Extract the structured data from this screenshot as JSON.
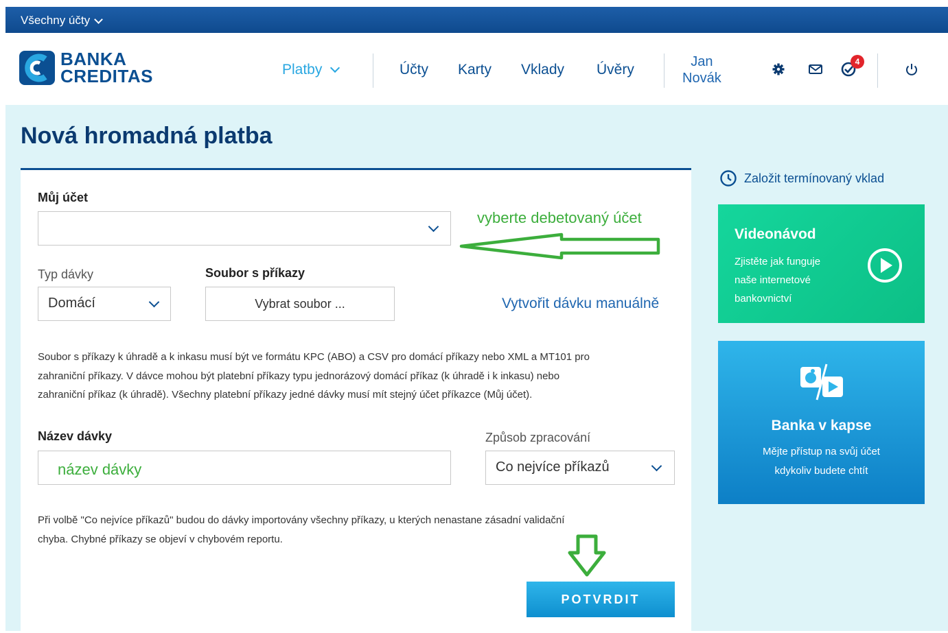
{
  "topbar": {
    "accounts_label": "Všechny účty"
  },
  "brand": {
    "line1": "BANKA",
    "line2": "CREDITAS"
  },
  "nav": {
    "payments": "Platby",
    "accounts": "Účty",
    "cards": "Karty",
    "deposits": "Vklady",
    "loans": "Úvěry"
  },
  "user": {
    "first_name": "Jan",
    "last_name": "Novák"
  },
  "notifications": {
    "count": "4"
  },
  "icons": {
    "settings": "gear-icon",
    "messages": "envelope-icon",
    "tasks": "check-badge-icon",
    "logout": "power-icon"
  },
  "page": {
    "title": "Nová hromadná platba"
  },
  "form": {
    "my_account_label": "Můj účet",
    "my_account_value": "",
    "batch_type_label": "Typ dávky",
    "batch_type_value": "Domácí",
    "file_label": "Soubor s příkazy",
    "file_button": "Vybrat soubor ...",
    "manual_link": "Vytvořit dávku manuálně",
    "info_line1": "Soubor s příkazy k úhradě a k inkasu musí být ve formátu KPC (ABO) a CSV pro domácí příkazy nebo XML a MT101 pro",
    "info_line2": "zahraniční příkazy. V dávce mohou být platební příkazy typu jednorázový domácí příkaz (k úhradě i k inkasu) nebo",
    "info_line3": "zahraniční příkaz (k úhradě). Všechny platební příkazy jedné dávky musí mít stejný účet příkazce (Můj účet).",
    "batch_name_label": "Název dávky",
    "batch_name_hint": "název dávky",
    "processing_label": "Způsob zpracování",
    "processing_value": "Co nejvíce příkazů",
    "note_line1": "Při volbě \"Co nejvíce příkazů\" budou do dávky importovány všechny příkazy, u kterých nenastane zásadní validační",
    "note_line2": "chyba. Chybné příkazy se objeví v chybovém reportu.",
    "confirm_button": "POTVRDIT"
  },
  "annotation": {
    "account_hint": "vyberte debetovaný účet",
    "color": "#3cae3c"
  },
  "sidebar": {
    "term_deposit_link": "Založit termínovaný vklad",
    "video": {
      "title": "Videonávod",
      "line1": "Zjistěte jak funguje",
      "line2": "naše internetové",
      "line3": "bankovnictví"
    },
    "mobile": {
      "title": "Banka v kapse",
      "line1": "Mějte přístup na svůj účet",
      "line2": "kdykoliv budete chtít"
    }
  },
  "colors": {
    "brand_blue": "#0b4f92",
    "active_blue": "#29a7e1",
    "page_bg": "#def4f8",
    "green_tile": "#12cf94",
    "badge_red": "#e2242b"
  }
}
